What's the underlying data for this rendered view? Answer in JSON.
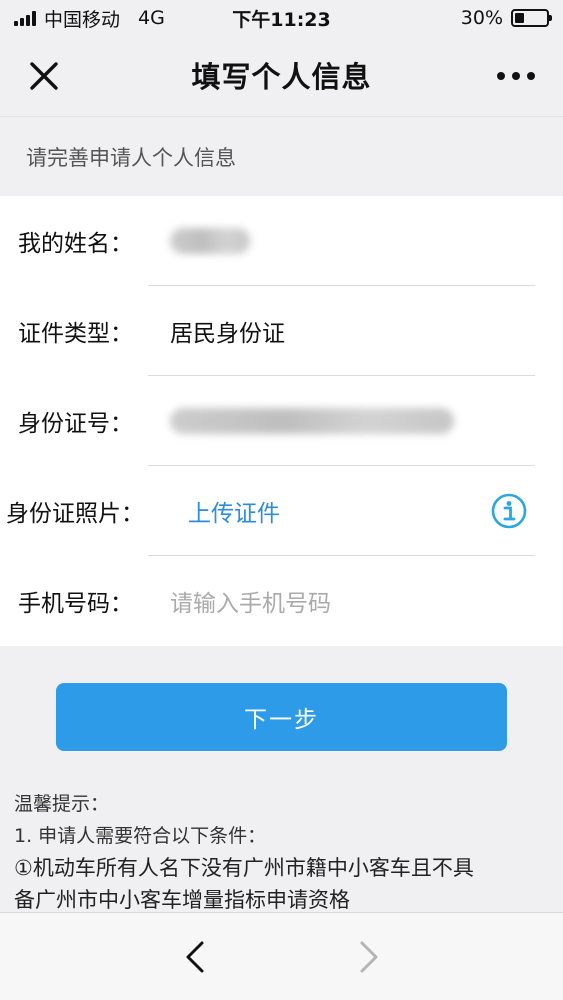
{
  "status_bar": {
    "carrier": "中国移动",
    "network": "4G",
    "time": "下午11:23",
    "battery_text": "30%",
    "battery_level": 0.3
  },
  "nav": {
    "title": "填写个人信息",
    "close_icon": "close-icon",
    "more_icon": "more-icon"
  },
  "section_hint": "请完善申请人个人信息",
  "form": {
    "name_label": "我的姓名：",
    "id_type_label": "证件类型：",
    "id_type_value": "居民身份证",
    "id_number_label": "身份证号：",
    "id_photo_label": "身份证照片：",
    "upload_link": "上传证件",
    "phone_label": "手机号码：",
    "phone_placeholder": "请输入手机号码"
  },
  "next_button": "下一步",
  "tips": {
    "title": "温馨提示：",
    "line1": "1. 申请人需要符合以下条件：",
    "line2": "①机动车所有人名下没有广州市籍中小客车且不具",
    "line3": "备广州市中小客车增量指标申请资格"
  },
  "colors": {
    "accent": "#2e9be8",
    "link": "#2d8cdc",
    "info": "#2aa6e0"
  }
}
